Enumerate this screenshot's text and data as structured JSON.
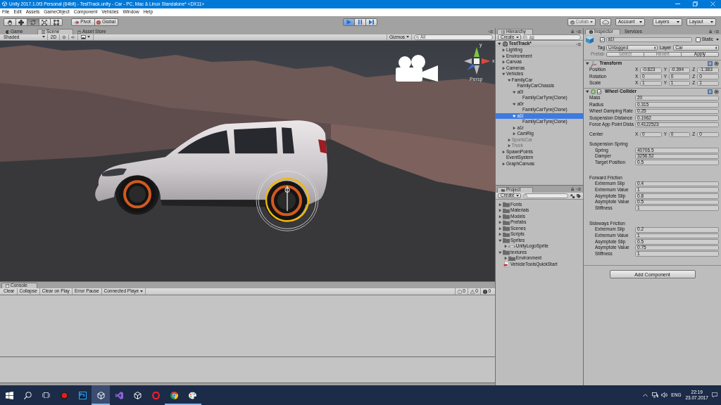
{
  "window": {
    "title": "Unity 2017.1.0f3 Personal (64bit) - TestTrack.unity - Car - PC, Mac & Linux Standalone* <DX11>"
  },
  "menu": [
    "File",
    "Edit",
    "Assets",
    "GameObject",
    "Component",
    "Vehicles",
    "Window",
    "Help"
  ],
  "toolbar": {
    "tools": [
      {
        "kind": "hand",
        "selected": false
      },
      {
        "kind": "move",
        "selected": false
      },
      {
        "kind": "rotate",
        "selected": true
      },
      {
        "kind": "scale",
        "selected": false
      },
      {
        "kind": "rect",
        "selected": false
      }
    ],
    "handles": [
      {
        "kind": "pivot",
        "label": "Pivot"
      },
      {
        "kind": "global",
        "label": "Global"
      }
    ],
    "playback": [
      {
        "kind": "play",
        "selected": true
      },
      {
        "kind": "pause",
        "selected": false
      },
      {
        "kind": "step",
        "selected": false
      }
    ],
    "collab": {
      "label": "Collab",
      "disabled": true
    },
    "dropdowns": [
      "Account",
      "Layers",
      "Layout"
    ]
  },
  "scene_panel": {
    "tabs": [
      {
        "kind": "game",
        "label": "Game",
        "selected": false
      },
      {
        "kind": "scene",
        "label": "Scene",
        "selected": true
      },
      {
        "kind": "store",
        "label": "Asset Store",
        "selected": false
      }
    ],
    "shading": "Shaded",
    "mode_2d": "2D",
    "toggles": [
      {
        "kind": "lighting",
        "on": true
      },
      {
        "kind": "audio",
        "on": false
      }
    ],
    "gizmos": "Gizmos",
    "search": {
      "placeholder": "All"
    },
    "axis_labels": [
      "y",
      "x"
    ],
    "view_label": "Persp"
  },
  "console": {
    "title": "Console",
    "buttons": [
      {
        "kind": "button",
        "label": "Clear"
      },
      {
        "kind": "button",
        "label": "Collapse"
      },
      {
        "kind": "button",
        "label": "Clear on Play"
      },
      {
        "kind": "button",
        "label": "Error Pause"
      },
      {
        "kind": "dropdown",
        "label": "Connected Playe"
      }
    ],
    "counts": [
      {
        "kind": "info",
        "value": "0"
      },
      {
        "kind": "warning",
        "value": "0"
      },
      {
        "kind": "error",
        "value": "0"
      }
    ]
  },
  "hierarchy": {
    "title": "Hierarchy",
    "create": "Create",
    "search": {
      "placeholder": "All"
    },
    "scene": {
      "label": "TestTrack*",
      "expanded": true
    },
    "items": [
      {
        "label": "Lighting",
        "expanded": false,
        "selected": false,
        "disabled": false
      },
      {
        "label": "Environment",
        "expanded": false,
        "selected": false,
        "disabled": false
      },
      {
        "label": "Canvas",
        "expanded": false,
        "selected": false,
        "disabled": false
      },
      {
        "label": "Cameras",
        "expanded": false,
        "selected": false,
        "disabled": false
      },
      {
        "label": "Vehicles",
        "expanded": true,
        "selected": false,
        "disabled": false,
        "children": [
          {
            "label": "FamilyCar",
            "expanded": true,
            "selected": false,
            "disabled": false,
            "children": [
              {
                "label": "FamilyCarChassis",
                "selected": false,
                "disabled": false
              },
              {
                "label": "a0l",
                "expanded": true,
                "selected": false,
                "disabled": false,
                "children": [
                  {
                    "label": "FamilyCarTyre(Clone)",
                    "selected": false,
                    "disabled": false
                  }
                ]
              },
              {
                "label": "a0r",
                "expanded": true,
                "selected": false,
                "disabled": false,
                "children": [
                  {
                    "label": "FamilyCarTyre(Clone)",
                    "selected": false,
                    "disabled": false
                  }
                ]
              },
              {
                "label": "a1l",
                "expanded": true,
                "selected": true,
                "disabled": false,
                "children": [
                  {
                    "label": "FamilyCarTyre(Clone)",
                    "selected": false,
                    "disabled": false
                  }
                ]
              },
              {
                "label": "a1r",
                "expanded": false,
                "selected": false,
                "disabled": false
              },
              {
                "label": "CamRig",
                "expanded": false,
                "selected": false,
                "disabled": false
              }
            ]
          },
          {
            "label": "SportsCar",
            "expanded": false,
            "selected": false,
            "disabled": true
          },
          {
            "label": "Truck",
            "expanded": false,
            "selected": false,
            "disabled": true
          }
        ]
      },
      {
        "label": "SpawnPoints",
        "expanded": false,
        "selected": false,
        "disabled": false
      },
      {
        "label": "EventSystem",
        "selected": false,
        "disabled": false
      },
      {
        "label": "GraphCanvas",
        "expanded": false,
        "selected": false,
        "disabled": false
      }
    ]
  },
  "project": {
    "title": "Project",
    "create": "Create",
    "items": [
      {
        "kind": "folder",
        "label": "Fonts",
        "expanded": false
      },
      {
        "kind": "folder",
        "label": "Materials",
        "expanded": false
      },
      {
        "kind": "folder",
        "label": "Models",
        "expanded": false
      },
      {
        "kind": "folder",
        "label": "Prefabs",
        "expanded": false
      },
      {
        "kind": "folder",
        "label": "Scenes",
        "expanded": false
      },
      {
        "kind": "folder",
        "label": "Scripts",
        "expanded": false
      },
      {
        "kind": "folder",
        "label": "Sprites",
        "expanded": true,
        "children": [
          {
            "kind": "sprite",
            "label": "UnityLogoSprite",
            "expanded": false
          }
        ]
      },
      {
        "kind": "folder",
        "label": "textures",
        "expanded": true,
        "children": [
          {
            "kind": "folder",
            "label": "Environment",
            "expanded": false
          }
        ]
      },
      {
        "kind": "document",
        "label": "VehicleToolsQuickStart"
      }
    ]
  },
  "inspector": {
    "tabs": [
      {
        "kind": "inspector",
        "label": "Inspector",
        "selected": true
      },
      {
        "kind": "services",
        "label": "Services",
        "selected": false
      }
    ],
    "object": {
      "active": true,
      "name": "a1l",
      "static": false,
      "static_label": "Static",
      "tag_label": "Tag",
      "tag": "Untagged",
      "layer_label": "Layer",
      "layer": "Car"
    },
    "prefab": {
      "label": "Prefab",
      "disabled": true,
      "buttons": [
        {
          "label": "Select",
          "disabled": true
        },
        {
          "label": "Revert",
          "disabled": true
        },
        {
          "label": "Apply",
          "disabled": false
        }
      ]
    },
    "components": [
      {
        "kind": "transform",
        "title": "Transform",
        "expanded": true,
        "rows": [
          {
            "kind": "vector",
            "label": "Position",
            "values": [
              {
                "axis": "X",
                "value": "-0.823"
              },
              {
                "axis": "Y",
                "value": "-0.394"
              },
              {
                "axis": "Z",
                "value": "-1.383"
              }
            ]
          },
          {
            "kind": "vector",
            "label": "Rotation",
            "values": [
              {
                "axis": "X",
                "value": "0"
              },
              {
                "axis": "Y",
                "value": "0"
              },
              {
                "axis": "Z",
                "value": "0"
              }
            ]
          },
          {
            "kind": "vector",
            "label": "Scale",
            "values": [
              {
                "axis": "X",
                "value": "1"
              },
              {
                "axis": "Y",
                "value": "1"
              },
              {
                "axis": "Z",
                "value": "1"
              }
            ]
          }
        ]
      },
      {
        "kind": "wheel_collider",
        "title": "Wheel Collider",
        "expanded": true,
        "enabled": true,
        "rows": [
          {
            "kind": "field",
            "label": "Mass",
            "value": "20"
          },
          {
            "kind": "field",
            "label": "Radius",
            "value": "0.315"
          },
          {
            "kind": "field",
            "label": "Wheel Damping Rate",
            "value": "0.25"
          },
          {
            "kind": "field",
            "label": "Suspension Distance",
            "value": "0.1962"
          },
          {
            "kind": "field",
            "label": "Force App Point Dista",
            "value": "0.4122523"
          },
          {
            "kind": "vector",
            "label": "Center",
            "values": [
              {
                "axis": "X",
                "value": "0"
              },
              {
                "axis": "Y",
                "value": "0"
              },
              {
                "axis": "Z",
                "value": "0"
              }
            ]
          },
          {
            "kind": "group",
            "label": "Suspension Spring",
            "rows": [
              {
                "label": "Spring",
                "value": "40706.5"
              },
              {
                "label": "Damper",
                "value": "3256.52"
              },
              {
                "label": "Target Position",
                "value": "0.5"
              }
            ]
          },
          {
            "kind": "group",
            "label": "Forward Friction",
            "rows": [
              {
                "label": "Extremum Slip",
                "value": "0.4"
              },
              {
                "label": "Extremum Value",
                "value": "1"
              },
              {
                "label": "Asymptote Slip",
                "value": "0.8"
              },
              {
                "label": "Asymptote Value",
                "value": "0.5"
              },
              {
                "label": "Stiffness",
                "value": "1"
              }
            ]
          },
          {
            "kind": "group",
            "label": "Sideways Friction",
            "rows": [
              {
                "label": "Extremum Slip",
                "value": "0.2"
              },
              {
                "label": "Extremum Value",
                "value": "1"
              },
              {
                "label": "Asymptote Slip",
                "value": "0.5"
              },
              {
                "label": "Asymptote Value",
                "value": "0.75"
              },
              {
                "label": "Stiffness",
                "value": "1"
              }
            ]
          }
        ]
      }
    ],
    "add_component": "Add Component"
  },
  "taskbar": {
    "apps": [
      {
        "kind": "record",
        "running": false,
        "selected": false
      },
      {
        "kind": "ps",
        "label": "Ps",
        "running": false,
        "selected": false
      },
      {
        "kind": "unity",
        "running": true,
        "selected": true
      },
      {
        "kind": "vs",
        "running": false,
        "selected": false
      },
      {
        "kind": "unity",
        "running": false,
        "selected": false
      },
      {
        "kind": "opera",
        "running": false,
        "selected": false
      },
      {
        "kind": "chrome",
        "running": true,
        "selected": false
      },
      {
        "kind": "paint",
        "running": true,
        "selected": false
      }
    ],
    "language": "ENG",
    "time": "22:19",
    "date": "23.07.2017"
  }
}
